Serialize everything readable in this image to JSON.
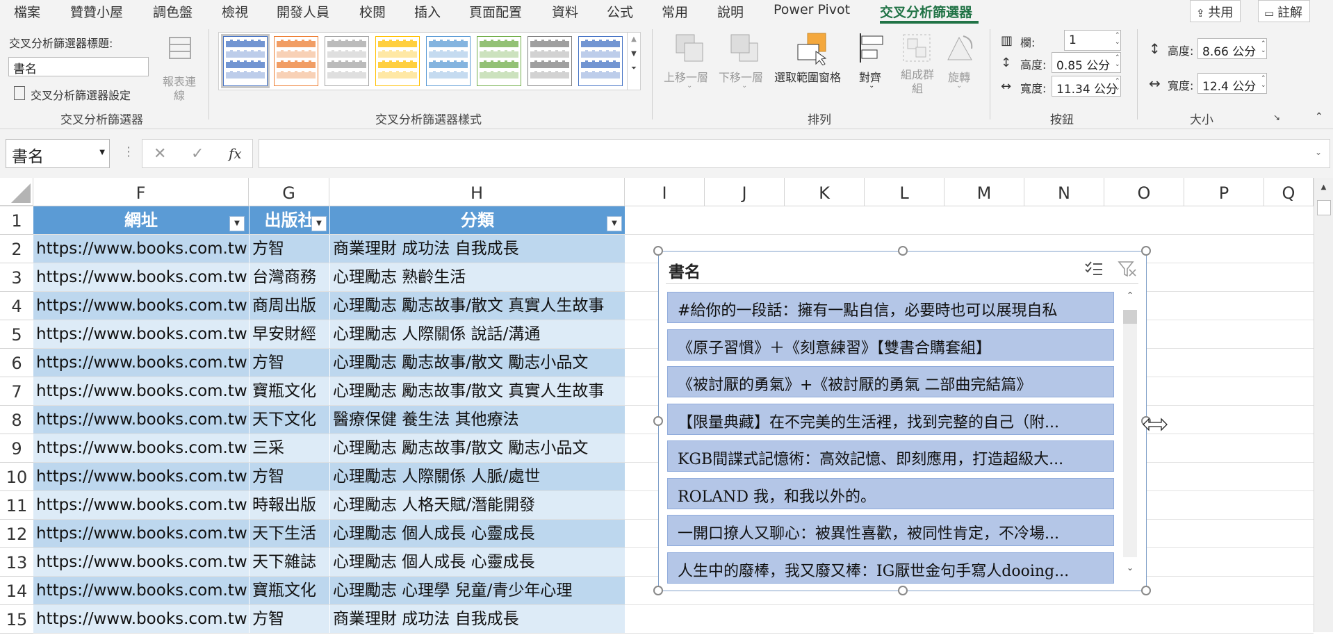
{
  "tabs": [
    "檔案",
    "贊贊小屋",
    "調色盤",
    "檢視",
    "開發人員",
    "校閱",
    "插入",
    "頁面配置",
    "資料",
    "公式",
    "常用",
    "說明",
    "Power Pivot",
    "交叉分析篩選器"
  ],
  "share_label": "共用",
  "comments_label": "註解",
  "ribbon": {
    "slicer_caption_label": "交叉分析篩選器標題:",
    "slicer_caption_value": "書名",
    "report_conn_label": "報表連線",
    "settings_label": "交叉分析篩選器設定",
    "group_slicer": "交叉分析篩選器",
    "group_styles": "交叉分析篩選器樣式",
    "group_arrange": "排列",
    "group_buttons": "按鈕",
    "group_size": "大小",
    "bring_forward": "上移一層",
    "send_backward": "下移一層",
    "selection_pane": "選取範圍窗格",
    "align": "對齊",
    "group": "組成群組",
    "rotate": "旋轉",
    "columns_label": "欄:",
    "columns_value": "1",
    "btn_height_label": "高度:",
    "btn_height_value": "0.85 公分",
    "btn_width_label": "寬度:",
    "btn_width_value": "11.34 公分",
    "height_label": "高度:",
    "height_value": "8.66 公分",
    "width_label": "寬度:",
    "width_value": "12.4 公分",
    "style_colors": [
      "#4472c4",
      "#ed7d31",
      "#a5a5a5",
      "#ffc000",
      "#5b9bd5",
      "#70ad47",
      "#7f7f7f",
      "#4472c4"
    ]
  },
  "formula_bar": {
    "name_box": "書名",
    "fx": "fx",
    "value": ""
  },
  "columns": [
    "F",
    "G",
    "H",
    "I",
    "J",
    "K",
    "L",
    "M",
    "N",
    "O",
    "P",
    "Q"
  ],
  "table": {
    "headers": [
      "網址",
      "出版社",
      "分類"
    ],
    "rows": [
      {
        "num": "1"
      },
      {
        "num": "2",
        "url": "https://www.books.com.tw",
        "pub": "方智",
        "cat": "商業理財 成功法 自我成長"
      },
      {
        "num": "3",
        "url": "https://www.books.com.tw",
        "pub": "台灣商務",
        "cat": "心理勵志 熟齡生活"
      },
      {
        "num": "4",
        "url": "https://www.books.com.tw",
        "pub": "商周出版",
        "cat": "心理勵志 勵志故事/散文 真實人生故事"
      },
      {
        "num": "5",
        "url": "https://www.books.com.tw",
        "pub": "早安財經",
        "cat": "心理勵志 人際關係 說話/溝通"
      },
      {
        "num": "6",
        "url": "https://www.books.com.tw",
        "pub": "方智",
        "cat": "心理勵志 勵志故事/散文 勵志小品文"
      },
      {
        "num": "7",
        "url": "https://www.books.com.tw",
        "pub": "寶瓶文化",
        "cat": "心理勵志 勵志故事/散文 真實人生故事"
      },
      {
        "num": "8",
        "url": "https://www.books.com.tw",
        "pub": "天下文化",
        "cat": "醫療保健 養生法 其他療法"
      },
      {
        "num": "9",
        "url": "https://www.books.com.tw",
        "pub": "三采",
        "cat": "心理勵志 勵志故事/散文 勵志小品文"
      },
      {
        "num": "10",
        "url": "https://www.books.com.tw",
        "pub": "方智",
        "cat": "心理勵志 人際關係 人脈/處世"
      },
      {
        "num": "11",
        "url": "https://www.books.com.tw",
        "pub": "時報出版",
        "cat": "心理勵志 人格天賦/潛能開發"
      },
      {
        "num": "12",
        "url": "https://www.books.com.tw",
        "pub": "天下生活",
        "cat": "心理勵志 個人成長 心靈成長"
      },
      {
        "num": "13",
        "url": "https://www.books.com.tw",
        "pub": "天下雜誌",
        "cat": "心理勵志 個人成長 心靈成長"
      },
      {
        "num": "14",
        "url": "https://www.books.com.tw",
        "pub": "寶瓶文化",
        "cat": "心理勵志 心理學 兒童/青少年心理"
      },
      {
        "num": "15",
        "url": "https://www.books.com.tw",
        "pub": "方智",
        "cat": "商業理財 成功法 自我成長"
      }
    ]
  },
  "slicer": {
    "title": "書名",
    "items": [
      "#給你的一段話：擁有一點自信，必要時也可以展現自私",
      "《原子習慣》＋《刻意練習》【雙書合購套組】",
      "《被討厭的勇氣》+《被討厭的勇氣 二部曲完結篇》",
      "【限量典藏】在不完美的生活裡，找到完整的自己（附...",
      "KGB間諜式記憶術：高效記憶、即刻應用，打造超級大...",
      "ROLAND 我，和我以外的。",
      "一開口撩人又聊心：被異性喜歡，被同性肯定，不冷場...",
      "人生中的廢棒，我又廢又棒：IG厭世金句手寫人dooing..."
    ]
  }
}
